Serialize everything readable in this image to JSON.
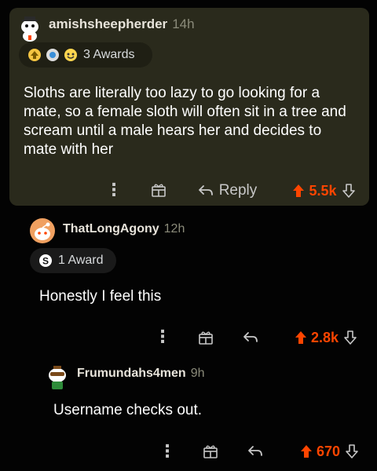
{
  "comments": [
    {
      "username": "amishsheepherder",
      "time": "14h",
      "awards": "3 Awards",
      "body": "Sloths are literally too lazy to go looking for a mate, so a female sloth will often sit in a tree and scream until a male hears her and decides to mate with her",
      "reply_label": "Reply",
      "votes": "5.5k"
    },
    {
      "username": "ThatLongAgony",
      "time": "12h",
      "awards": "1 Award",
      "body": "Honestly I feel this",
      "votes": "2.8k"
    },
    {
      "username": "Frumundahs4men",
      "time": "9h",
      "body": "Username checks out.",
      "votes": "670"
    }
  ],
  "colors": {
    "highlight_bg": "#2a2a1c",
    "upvote": "#ff4500",
    "page_bg": "#030303"
  },
  "icons": [
    "more-options-icon",
    "award-icon",
    "reply-icon",
    "upvote-icon",
    "downvote-icon"
  ]
}
